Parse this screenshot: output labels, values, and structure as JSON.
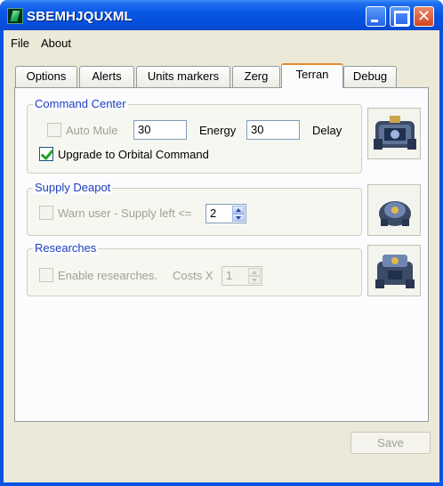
{
  "window": {
    "title": "SBEMHJQUXML"
  },
  "menu": {
    "file": "File",
    "about": "About"
  },
  "tabs": [
    {
      "label": "Options"
    },
    {
      "label": "Alerts"
    },
    {
      "label": "Units markers"
    },
    {
      "label": "Zerg"
    },
    {
      "label": "Terran",
      "active": true
    },
    {
      "label": "Debug"
    }
  ],
  "command_center": {
    "title": "Command Center",
    "auto_mule_label": "Auto Mule",
    "auto_mule_checked": false,
    "energy_value": "30",
    "energy_label": "Energy",
    "delay_value": "30",
    "delay_label": "Delay",
    "upgrade_label": "Upgrade to Orbital Command",
    "upgrade_checked": true,
    "icon": "command-center-icon"
  },
  "supply_depot": {
    "title": "Supply Deapot",
    "warn_label": "Warn user - Supply left <=",
    "warn_checked": false,
    "supply_value": "2",
    "icon": "supply-depot-icon"
  },
  "researches": {
    "title": "Researches",
    "enable_label": "Enable researches.",
    "enable_checked": false,
    "costs_label": "Costs X",
    "costs_value": "1",
    "icon": "engineering-bay-icon"
  },
  "buttons": {
    "save": "Save"
  },
  "colors": {
    "group_title": "#1c3fc0",
    "title_bar": "#0a58e6",
    "tab_active_accent": "#e68b2c"
  }
}
